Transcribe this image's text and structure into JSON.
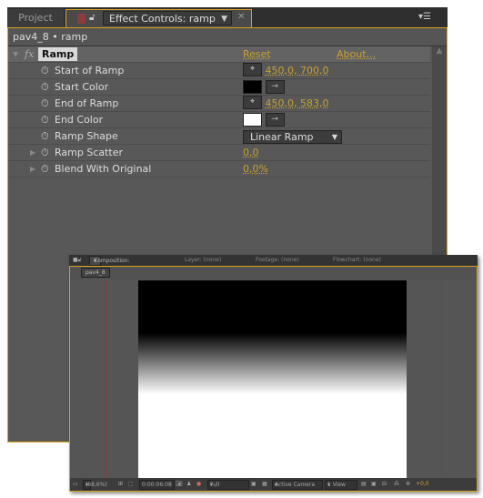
{
  "effect_controls": {
    "tab_project": "Project",
    "tab_title": "Effect Controls: ramp",
    "breadcrumb": "pav4_8 • ramp",
    "effect_name": "Ramp",
    "reset": "Reset",
    "about": "About...",
    "properties": [
      {
        "label": "Start of Ramp",
        "value": "450,0, 700,0"
      },
      {
        "label": "Start Color",
        "color": "#000000"
      },
      {
        "label": "End of Ramp",
        "value": "450,0, 583,0"
      },
      {
        "label": "End Color",
        "color": "#ffffff"
      },
      {
        "label": "Ramp Shape",
        "value": "Linear Ramp"
      },
      {
        "label": "Ramp Scatter",
        "value": "0,0"
      },
      {
        "label": "Blend With Original",
        "value": "0,0%"
      }
    ]
  },
  "composition": {
    "tab_comp": "Composition: pav4_8",
    "tab_layer": "Layer: (none)",
    "tab_footage": "Footage: (none)",
    "tab_flowchart": "Flowchart: (none)",
    "subtab": "pav4_8",
    "zoom": "(68,6%)",
    "timecode": "0:00:06:08",
    "resolution": "Full",
    "camera": "Active Camera",
    "views": "1 View",
    "exposure": "+0,0"
  }
}
